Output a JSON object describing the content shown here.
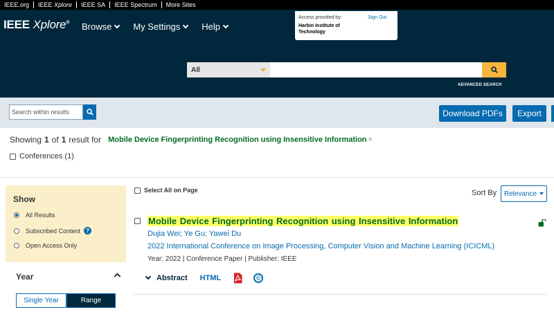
{
  "top_links": [
    {
      "label": "IEEE.org"
    },
    {
      "label_prefix": "IEEE ",
      "label_em": "Xplore"
    },
    {
      "label": "IEEE SA"
    },
    {
      "label": "IEEE Spectrum"
    },
    {
      "label": "More Sites"
    }
  ],
  "logo": {
    "part1": "IEEE ",
    "part2": "Xplore",
    "mark": "®"
  },
  "nav": [
    {
      "label": "Browse"
    },
    {
      "label": "My Settings"
    },
    {
      "label": "Help"
    }
  ],
  "access": {
    "label": "Access provided by:",
    "institution": "Harbin Institute of Technology",
    "sign_out": "Sign Out"
  },
  "search": {
    "scope": "All",
    "query": "",
    "advanced": "ADVANCED SEARCH"
  },
  "toolbar": {
    "within_placeholder": "Search within results",
    "download": "Download PDFs",
    "export": "Export"
  },
  "summary": {
    "prefix": "Showing",
    "shown": "1",
    "of": "of",
    "total": "1",
    "result_for": "result  for",
    "query": "Mobile Device Fingerprinting Recognition using Insensitive Information",
    "clear": "×"
  },
  "filters": {
    "conferences": "Conferences (1)"
  },
  "show_panel": {
    "title": "Show",
    "options": [
      {
        "label": "All Results",
        "selected": true
      },
      {
        "label": "Subscribed Content",
        "selected": false
      },
      {
        "label": "Open Access Only",
        "selected": false
      }
    ],
    "help_icon": "?"
  },
  "year_panel": {
    "title": "Year",
    "single": "Single Year",
    "range": "Range"
  },
  "results_header": {
    "select_all": "Select All on Page",
    "sort_by": "Sort By",
    "sort_value": "Relevance"
  },
  "result": {
    "title": "Mobile Device Fingerprinting Recognition using Insensitive Information",
    "authors": "Dujia Wei; Ye Gu; Yawei Du",
    "venue": "2022 International Conference on Image Processing, Computer Vision and Machine Learning (ICICML)",
    "meta": "Year: 2022  |  Conference Paper  |  Publisher: IEEE",
    "abstract": "Abstract",
    "html": "HTML",
    "copyright": "©"
  },
  "colors": {
    "header": "#00273c",
    "link": "#066bb0",
    "accent": "#f8b53c",
    "title_green": "#006b23",
    "highlight": "#ffff66",
    "show_panel": "#fbefc9"
  }
}
